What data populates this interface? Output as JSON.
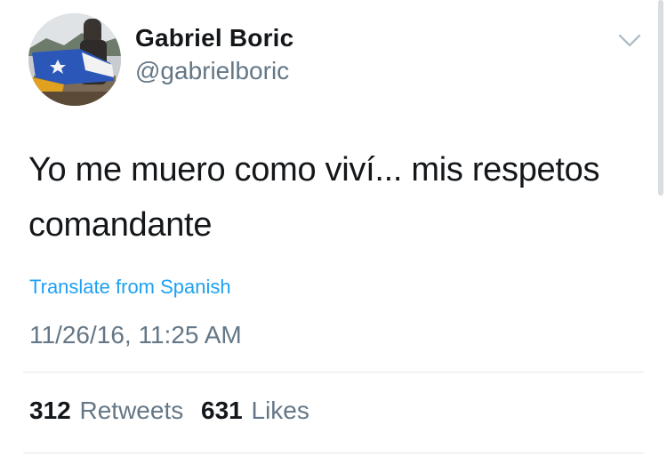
{
  "user": {
    "display_name": "Gabriel Boric",
    "handle": "@gabrielboric"
  },
  "tweet": {
    "text": "Yo me muero como viví... mis respetos comandante",
    "translate_label": "Translate from Spanish",
    "timestamp": "11/26/16, 11:25 AM"
  },
  "stats": {
    "retweets_count": "312",
    "retweets_label": "Retweets",
    "likes_count": "631",
    "likes_label": "Likes"
  },
  "icons": {
    "menu": "chevron-down-icon"
  },
  "colors": {
    "link": "#1da1f2",
    "secondary_text": "#657786",
    "primary_text": "#14171a"
  }
}
